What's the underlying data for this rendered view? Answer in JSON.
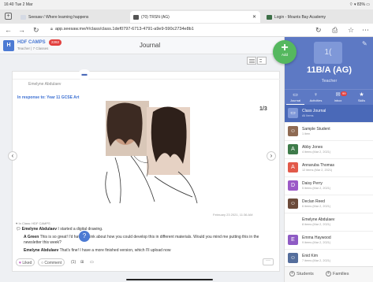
{
  "status": {
    "time": "16:40",
    "date": "Tue 2 Mar",
    "right": "⌔ ▾ 83% ▭"
  },
  "tabs": [
    {
      "label": "Seesaw / Where learning happens",
      "favicon_color": "#d5dae4"
    },
    {
      "label": "(70) TRSN (AG)",
      "favicon_color": "#555555"
    },
    {
      "label": "Login - Mounts Bay Academy",
      "favicon_color": "#3c6e46"
    }
  ],
  "address": {
    "url": "app.seesaw.me/#/class/class.1def0797-6713-4791-a9e9-590c2734e8b1"
  },
  "browser_icons": {
    "back": "←",
    "forward": "→",
    "reload": "↻",
    "reload_right": "↻",
    "share": "⎙",
    "star": "☆",
    "menu": "⋯"
  },
  "app_header": {
    "tile": "H",
    "class_name": "HDF CAMPS",
    "subtitle": "Teacher | 7 Classes",
    "badge": "2282",
    "title": "Journal"
  },
  "fab": {
    "label": "Add"
  },
  "post": {
    "author": "Emelyne Abdulaev",
    "in_response": "In response to: Year 11 GCSE Art",
    "counter": "1/3",
    "date": "February 23 2021, 11:36 AM",
    "via": "In Class: HDF CAMPS",
    "line1_author": "Emelyne Abdulaev",
    "line1_text": "I started a digital drawing.",
    "comment1_author": "A Green",
    "comment1_text": "This is so great! I'd have a think about how you could develop this in different materials. Would you mind me putting this in the newsletter this week?",
    "comment2_author": "Emelyne Abdulaev",
    "comment2_text": "That's fine! I have a more finished version, which I'll upload now",
    "actions": {
      "liked": "Liked",
      "comment": "Comment",
      "count1": "(1)",
      "icon2": "⊞",
      "icon3": "▭",
      "more": "···"
    }
  },
  "panel": {
    "avatar": "1(",
    "class_name": "11B/A (AG)",
    "role": "Teacher",
    "nav": [
      {
        "label": "Journal",
        "icon": "▭"
      },
      {
        "label": "Activities",
        "icon": "♀"
      },
      {
        "label": "Inbox",
        "icon": "✉"
      },
      {
        "label": "Skills",
        "icon": "★"
      }
    ],
    "nav_badge": "99",
    "rows": [
      {
        "name": "Class Journal",
        "sub": "All Items",
        "thumb": "▭",
        "color": "#7f98d8"
      },
      {
        "name": "Sample Student",
        "sub": "1 item",
        "thumb": "☺",
        "color": "#8e6a53"
      },
      {
        "name": "Abby Jones",
        "sub": "4 items (Mar 2, 2021)",
        "thumb": "A",
        "color": "#3e7b4a"
      },
      {
        "name": "Annaruba Thomas",
        "sub": "12 items (Mar 2, 2021)",
        "thumb": "A",
        "color": "#e25a4a"
      },
      {
        "name": "Daisy Perry",
        "sub": "5 items (Mar 2, 2021)",
        "thumb": "D",
        "color": "#9b59c7"
      },
      {
        "name": "Declan Reed",
        "sub": "6 items (Mar 2, 2021)",
        "thumb": "☺",
        "color": "#6b4a3a"
      },
      {
        "name": "Emelyne Abdulaev",
        "sub": "8 items (Mar 2, 2021)",
        "thumb": "",
        "color": "#ffffff"
      },
      {
        "name": "Emma Haywood",
        "sub": "9 items (Mar 2, 2021)",
        "thumb": "E",
        "color": "#8e5bc4"
      },
      {
        "name": "Enid Kim",
        "sub": "7 items (Mar 2, 2021)",
        "thumb": "☺",
        "color": "#556e9c"
      }
    ],
    "footer": {
      "students": "Students",
      "families": "Families",
      "help": "?"
    }
  }
}
